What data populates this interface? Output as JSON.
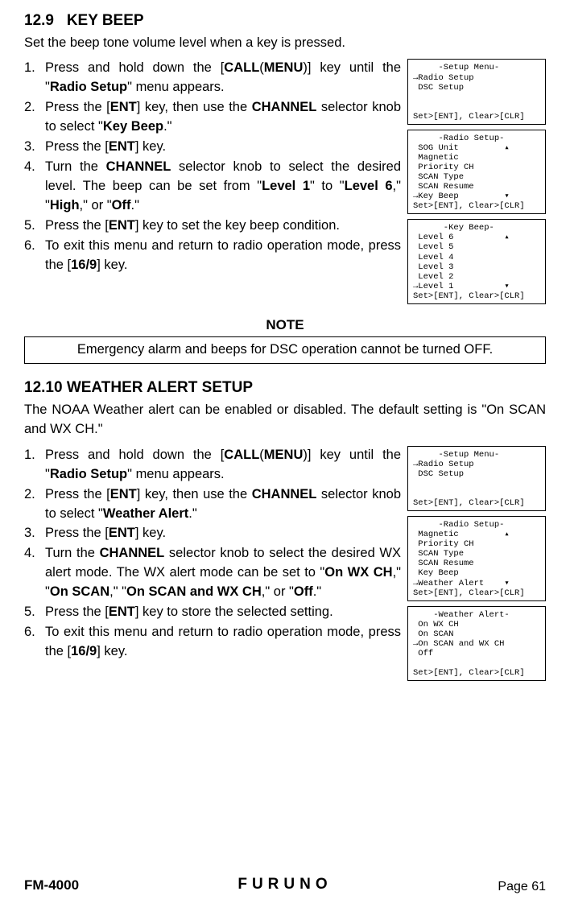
{
  "section1": {
    "number": "12.9",
    "title": "KEY BEEP",
    "intro": "Set the beep tone volume level when a key is pressed.",
    "steps": [
      {
        "n": "1.",
        "t": "Press and hold down the [<b>CALL</b>(<b>MENU</b>)] key until the \"<b>Radio Setup</b>\" menu appears."
      },
      {
        "n": "2.",
        "t": "Press the [<b>ENT</b>] key, then use the <b>CHANNEL</b> selector knob to select \"<b>Key Beep</b>.\""
      },
      {
        "n": "3.",
        "t": "Press the [<b>ENT</b>] key."
      },
      {
        "n": "4.",
        "t": "Turn the <b>CHANNEL</b> selector knob to select the desired level. The beep can be set from \"<b>Level 1</b>\" to \"<b>Level 6</b>,\" \"<b>High</b>,\" or \"<b>Off</b>.\""
      },
      {
        "n": "5.",
        "t": "Press the [<b>ENT</b>] key to set the key beep condition."
      },
      {
        "n": "6.",
        "t": "To exit this menu and return to radio operation mode, press the [<b>16/9</b>] key."
      }
    ],
    "screens": [
      "     -Setup Menu-\n→Radio Setup\n DSC Setup\n\n\nSet>[ENT], Clear>[CLR]",
      "     -Radio Setup-\n SOG Unit         ▴\n Magnetic\n Priority CH\n SCAN Type\n SCAN Resume\n→Key Beep         ▾\nSet>[ENT], Clear>[CLR]",
      "      -Key Beep-\n Level 6          ▴\n Level 5\n Level 4\n Level 3\n Level 2\n→Level 1          ▾\nSet>[ENT], Clear>[CLR]"
    ]
  },
  "note": {
    "title": "NOTE",
    "body": "Emergency alarm and beeps for DSC operation cannot be turned OFF."
  },
  "section2": {
    "number": "12.10",
    "title": "WEATHER ALERT SETUP",
    "intro": "The NOAA Weather alert can be enabled or disabled. The default setting is \"On SCAN and WX CH.\"",
    "steps": [
      {
        "n": "1.",
        "t": "Press and hold down the [<b>CALL</b>(<b>MENU</b>)] key until the \"<b>Radio Setup</b>\" menu appears."
      },
      {
        "n": "2.",
        "t": "Press the [<b>ENT</b>] key, then use the <b>CHANNEL</b> selector knob to select \"<b>Weather Alert</b>.\""
      },
      {
        "n": "3.",
        "t": "Press the [<b>ENT</b>] key."
      },
      {
        "n": "4.",
        "t": "Turn the <b>CHANNEL</b> selector knob to select the desired WX alert mode. The WX alert mode can be set to \"<b>On WX CH</b>,\" \"<b>On SCAN</b>,\" \"<b>On SCAN and WX CH</b>,\" or \"<b>Off</b>.\""
      },
      {
        "n": "5.",
        "t": "Press the [<b>ENT</b>] key to store the selected setting."
      },
      {
        "n": "6.",
        "t": "To exit this menu and return to radio operation mode, press the [<b>16/9</b>] key."
      }
    ],
    "screens": [
      "     -Setup Menu-\n→Radio Setup\n DSC Setup\n\n\nSet>[ENT], Clear>[CLR]",
      "     -Radio Setup-\n Magnetic         ▴\n Priority CH\n SCAN Type\n SCAN Resume\n Key Beep\n→Weather Alert    ▾\nSet>[ENT], Clear>[CLR]",
      "    -Weather Alert-\n On WX CH\n On SCAN\n→On SCAN and WX CH\n Off\n\nSet>[ENT], Clear>[CLR]"
    ]
  },
  "footer": {
    "model": "FM-4000",
    "brand": "FURUNO",
    "page": "Page 61"
  }
}
